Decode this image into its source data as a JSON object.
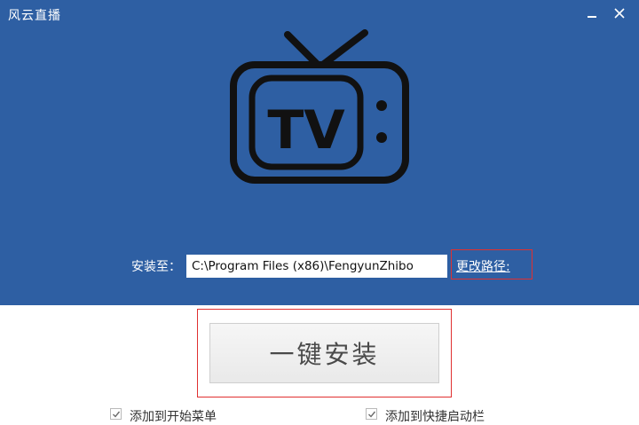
{
  "window": {
    "title": "风云直播",
    "minimize_icon": "minimize-icon",
    "close_icon": "close-icon"
  },
  "logo": {
    "icon": "tv-icon",
    "text": "TV"
  },
  "install_path": {
    "label": "安装至：",
    "value": "C:\\Program Files (x86)\\FengyunZhibo",
    "change_link": "更改路径:"
  },
  "install_button": {
    "label": "一键安装"
  },
  "options": [
    {
      "label": "添加到开始菜单",
      "checked": true
    },
    {
      "label": "添加到快捷启动栏",
      "checked": true
    }
  ],
  "colors": {
    "header_bg": "#2e5fa3",
    "highlight_outline": "#e03030"
  }
}
